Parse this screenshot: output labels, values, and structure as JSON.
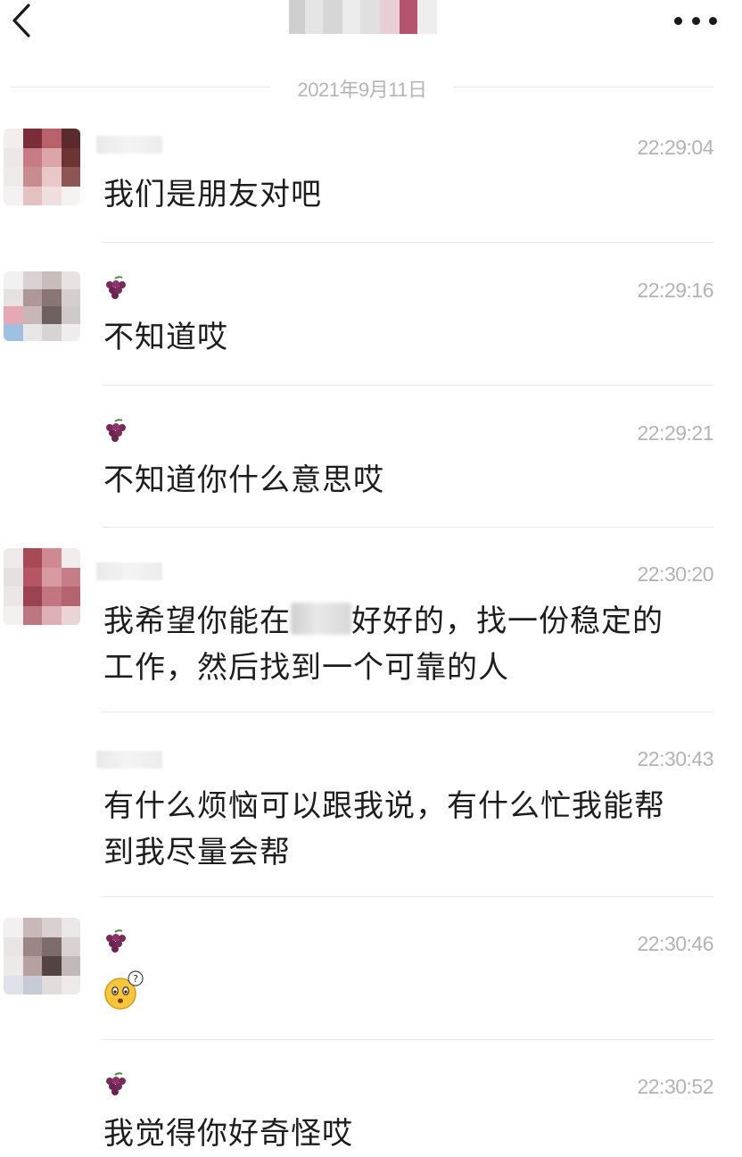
{
  "header": {
    "back_icon": "chevron-left-icon",
    "more_icon": "more-horizontal-icon"
  },
  "date_separator": "2021年9月11日",
  "colors": {
    "background": "#ffffff",
    "text": "#1d1d1d",
    "timestamp": "#b3b3b3",
    "divider": "#e7e7e7",
    "grape": "#7a2a5a"
  },
  "messages": [
    {
      "sender": "contact",
      "badge_icon": "",
      "time": "22:29:04",
      "text": "我们是朋友对吧"
    },
    {
      "sender": "self",
      "badge_icon": "grape-emoji-icon",
      "time": "22:29:16",
      "text": "不知道哎"
    },
    {
      "sender": "self",
      "badge_icon": "grape-emoji-icon",
      "time": "22:29:21",
      "text": "不知道你什么意思哎"
    },
    {
      "sender": "contact",
      "badge_icon": "",
      "time": "22:30:20",
      "text_before": "我希望你能在",
      "text_after": "好好的，找一份稳定的",
      "text_line2": "工作，然后找到一个可靠的人"
    },
    {
      "sender": "contact",
      "badge_icon": "",
      "time": "22:30:43",
      "text": "有什么烦恼可以跟我说，有什么忙我能帮",
      "text_line2": "到我尽量会帮"
    },
    {
      "sender": "self",
      "badge_icon": "grape-emoji-icon",
      "time": "22:30:46",
      "emoji": "confused-face-emoji-icon"
    },
    {
      "sender": "self",
      "badge_icon": "grape-emoji-icon",
      "time": "22:30:52",
      "text": "我觉得你好奇怪哎"
    }
  ]
}
